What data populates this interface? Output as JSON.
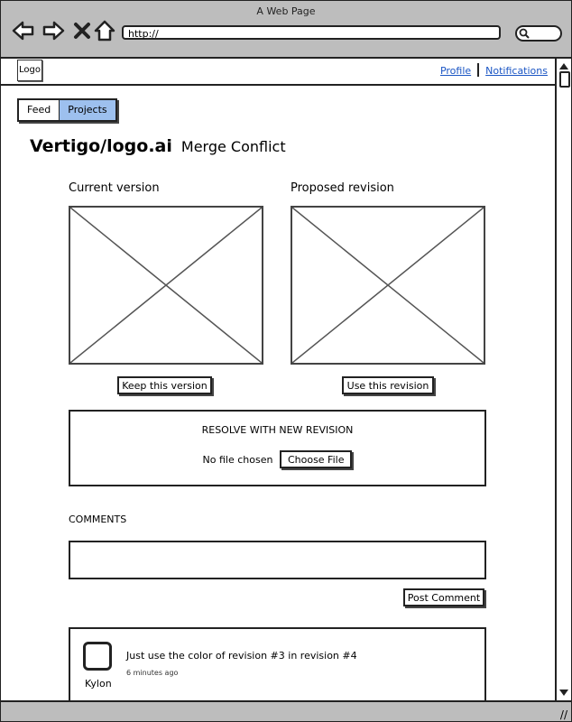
{
  "browser": {
    "title": "A Web Page",
    "url": "http://"
  },
  "appbar": {
    "logo": "Logo",
    "links": {
      "profile": "Profile",
      "notifications": "Notifications"
    }
  },
  "tabs": {
    "feed": "Feed",
    "projects": "Projects",
    "active": "Projects"
  },
  "page": {
    "project": "Vertigo/logo.ai",
    "subtitle": "Merge Conflict"
  },
  "versions": {
    "current_label": "Current version",
    "proposed_label": "Proposed revision",
    "keep_button": "Keep this version",
    "use_button": "Use this revision"
  },
  "resolve": {
    "title": "RESOLVE WITH NEW REVISION",
    "file_status": "No file chosen",
    "choose_button": "Choose File"
  },
  "comments": {
    "label": "COMMENTS",
    "input_value": "",
    "post_button": "Post Comment",
    "items": [
      {
        "author": "Kylon",
        "text": "Just use the color of revision #3 in revision #4",
        "time": "6 minutes ago"
      }
    ]
  },
  "colors": {
    "chrome": "#bdbdbd",
    "active_tab": "#9dc0ee",
    "link": "#1a55c4"
  }
}
